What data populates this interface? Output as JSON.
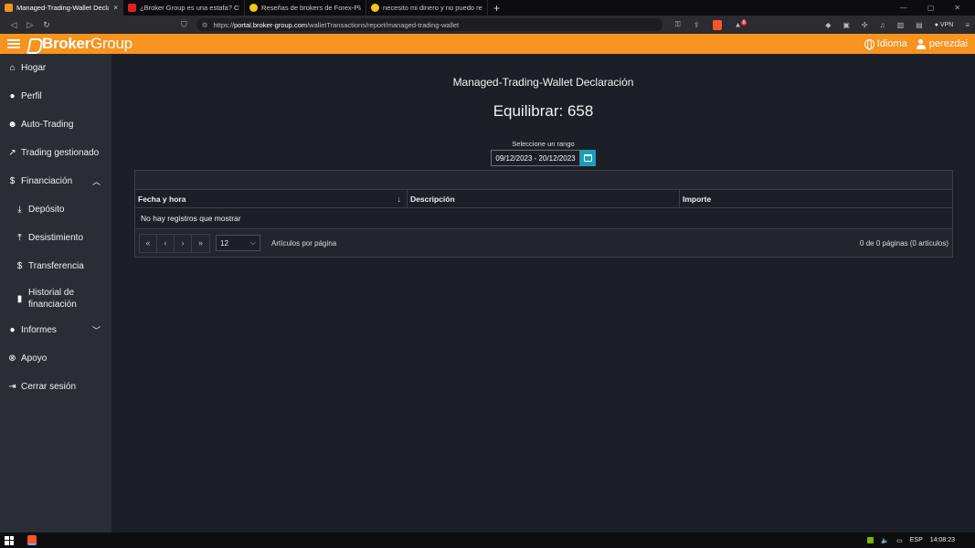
{
  "browser": {
    "tabs": [
      {
        "title": "Managed-Trading-Wallet Declar",
        "active": true,
        "favicon": "brokergroup-favicon",
        "close": "×"
      },
      {
        "title": "¿Broker Group es una estafa? Cliente",
        "active": false,
        "favicon": "youtube-favicon"
      },
      {
        "title": "Reseñas de brokers de Forex-Plataform",
        "active": false,
        "favicon": "forex-favicon"
      },
      {
        "title": "necesito mi dinero y no puedo retirar",
        "active": false,
        "favicon": "forex-favicon"
      }
    ],
    "new_tab": "+",
    "url_prefix": "https://",
    "url_host": "portal.broker-group.com",
    "url_path": "/walletTransactions/report/managed-trading-wallet",
    "brave_badge": "8",
    "vpn_label": "VPN"
  },
  "header": {
    "brand_bold": "Broker",
    "brand_light": "Group",
    "language_label": "Idioma",
    "username": "perezdai",
    "brand_color": "#f7931e"
  },
  "sidebar": {
    "items": [
      {
        "label": "Hogar",
        "icon": "home-icon"
      },
      {
        "label": "Perfil",
        "icon": "user-icon"
      },
      {
        "label": "Auto-Trading",
        "icon": "robot-icon"
      },
      {
        "label": "Trading gestionado",
        "icon": "chart-line-icon"
      },
      {
        "label": "Financiación",
        "icon": "money-icon",
        "expanded": true
      },
      {
        "label": "Depósito",
        "icon": "download-icon"
      },
      {
        "label": "Desistimiento",
        "icon": "upload-icon"
      },
      {
        "label": "Transferencia",
        "icon": "transfer-icon"
      },
      {
        "label": "Historial de financiación",
        "icon": "file-icon"
      },
      {
        "label": "Informes",
        "icon": "info-icon",
        "expanded": false
      },
      {
        "label": "Apoyo",
        "icon": "support-icon"
      },
      {
        "label": "Cerrar sesión",
        "icon": "logout-icon"
      }
    ]
  },
  "main": {
    "title": "Managed-Trading-Wallet Declaración",
    "balance": "Equilibrar: 658",
    "range_label": "Seleccione un rango",
    "range_value": "09/12/2023 - 20/12/2023",
    "table": {
      "columns": [
        "Fecha y hora",
        "Descripción",
        "Importe"
      ],
      "empty_message": "No hay registros que mostrar"
    },
    "pager": {
      "first": "«",
      "prev": "‹",
      "next": "›",
      "last": "»",
      "per_page_value": "12",
      "per_page_label": "Artículos por página",
      "info": "0 de 0 páginas (0 artículos)"
    }
  },
  "taskbar": {
    "lang": "ESP",
    "time": "14:08:23"
  }
}
